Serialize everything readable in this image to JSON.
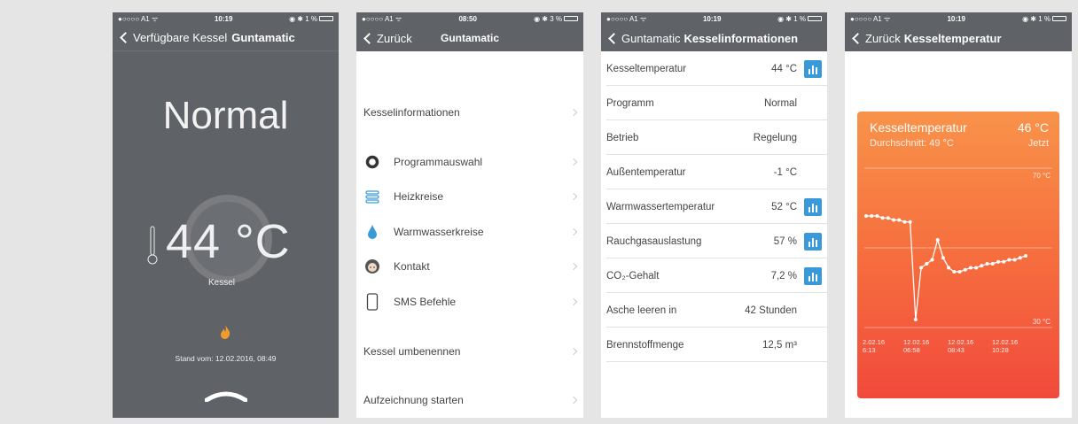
{
  "status": {
    "p1": {
      "carrier": "●○○○○ A1 ᯤ",
      "time": "10:19",
      "battery": "◉ ✱ 1 %"
    },
    "p2": {
      "carrier": "●○○○○ A1 ᯤ",
      "time": "08:50",
      "battery": "◉ ✱ 3 %"
    },
    "p3": {
      "carrier": "●○○○○ A1 ᯤ",
      "time": "10:19",
      "battery": "◉ ✱ 1 %"
    },
    "p4": {
      "carrier": "●○○○○ A1 ᯤ",
      "time": "10:19",
      "battery": "◉ ✱ 1 %"
    }
  },
  "screen1": {
    "back": "Verfügbare Kessel",
    "title": "Guntamatic",
    "mode": "Normal",
    "temperature": "44 °C",
    "label": "Kessel",
    "stand": "Stand vom: 12.02.2016, 08:49"
  },
  "screen2": {
    "back": "Zurück",
    "title": "Guntamatic",
    "items": [
      {
        "label": "Kesselinformationen",
        "icon": ""
      },
      {
        "label": "Programmauswahl",
        "icon": "ring-icon"
      },
      {
        "label": "Heizkreise",
        "icon": "radiator-icon"
      },
      {
        "label": "Warmwasserkreise",
        "icon": "water-drop-icon"
      },
      {
        "label": "Kontakt",
        "icon": "avatar-icon"
      },
      {
        "label": "SMS Befehle",
        "icon": "phone-icon"
      },
      {
        "label": "Kessel umbenennen",
        "icon": ""
      },
      {
        "label": "Aufzeichnung starten",
        "icon": ""
      }
    ]
  },
  "screen3": {
    "back": "Guntamatic",
    "title": "Kesselinformationen",
    "rows": [
      {
        "label": "Kesseltemperatur",
        "value": "44 °C",
        "chart": true
      },
      {
        "label": "Programm",
        "value": "Normal",
        "chart": false
      },
      {
        "label": "Betrieb",
        "value": "Regelung",
        "chart": false
      },
      {
        "label": "Außentemperatur",
        "value": "-1 °C",
        "chart": false
      },
      {
        "label": "Warmwassertemperatur",
        "value": "52 °C",
        "chart": true
      },
      {
        "label": "Rauchgasauslastung",
        "value": "57 %",
        "chart": true
      },
      {
        "label": "CO₂-Gehalt",
        "value": "7,2 %",
        "chart": true
      },
      {
        "label": "Asche leeren in",
        "value": "42 Stunden",
        "chart": false
      },
      {
        "label": "Brennstoffmenge",
        "value": "12,5 m³",
        "chart": false
      }
    ]
  },
  "screen4": {
    "back": "Zurück",
    "title": "Kesseltemperatur",
    "card_title": "Kesseltemperatur",
    "card_value": "46 °C",
    "average": "Durchschnitt: 49 °C",
    "now": "Jetzt",
    "colors": {
      "top": "#f8934a",
      "bottom": "#f14a3c"
    }
  },
  "chart_data": {
    "type": "line",
    "ylim": [
      30,
      70
    ],
    "yticks": [
      "70 °C",
      "30 °C"
    ],
    "xticks": [
      {
        "date": "2.02.16",
        "time": "6:13"
      },
      {
        "date": "12.02.16",
        "time": "06:58"
      },
      {
        "date": "12.02.16",
        "time": "08:43"
      },
      {
        "date": "12.02.16",
        "time": "10:28"
      }
    ],
    "x": [
      0,
      1,
      2,
      3,
      4,
      5,
      6,
      7,
      8,
      9,
      10,
      11,
      12,
      13,
      14,
      15,
      16,
      17,
      18,
      19,
      20,
      21,
      22,
      23,
      24,
      25,
      26,
      27,
      28,
      29
    ],
    "values": [
      58,
      58,
      58,
      57.5,
      57.5,
      57,
      57,
      56.5,
      56.5,
      32,
      45,
      46,
      47,
      52,
      47.5,
      45,
      44,
      44,
      44.5,
      45,
      45,
      45.5,
      46,
      46,
      46.5,
      46.5,
      47,
      47,
      47.5,
      48
    ]
  }
}
